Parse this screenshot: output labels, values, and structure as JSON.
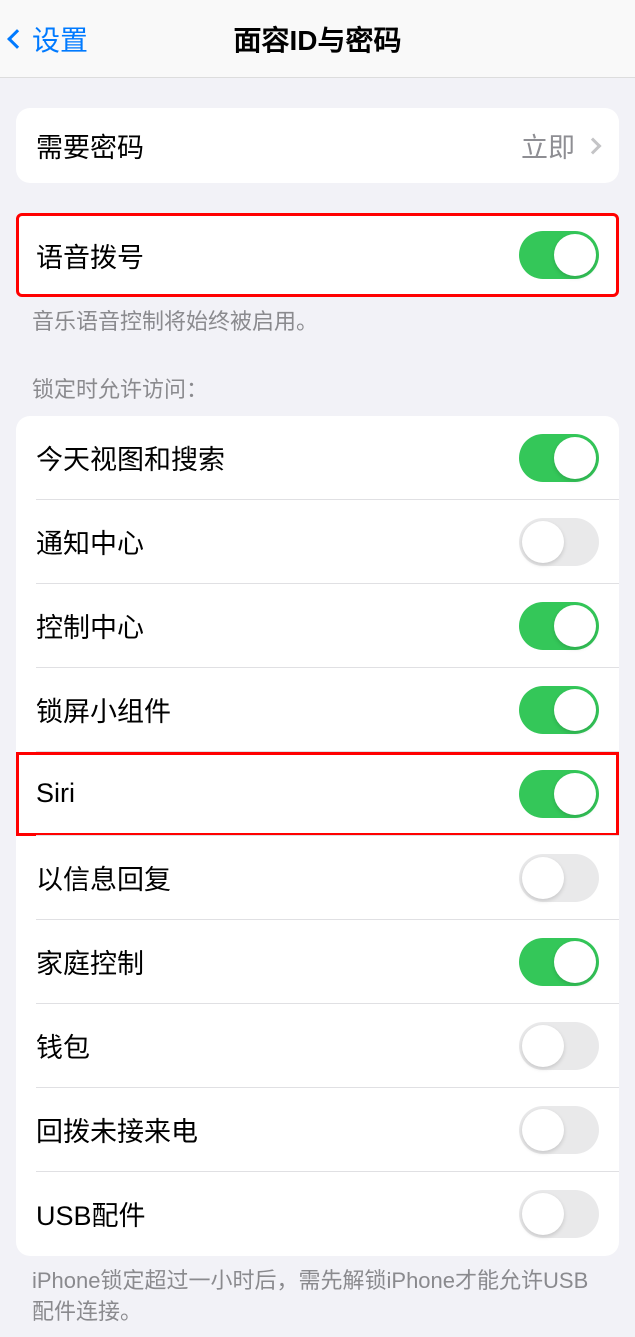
{
  "header": {
    "back_label": "设置",
    "title": "面容ID与密码"
  },
  "require_passcode": {
    "label": "需要密码",
    "value": "立即"
  },
  "voice_dial": {
    "label": "语音拨号",
    "enabled": true,
    "footer": "音乐语音控制将始终被启用。"
  },
  "lock_section": {
    "header": "锁定时允许访问：",
    "items": [
      {
        "label": "今天视图和搜索",
        "enabled": true,
        "highlighted": false
      },
      {
        "label": "通知中心",
        "enabled": false,
        "highlighted": false
      },
      {
        "label": "控制中心",
        "enabled": true,
        "highlighted": false
      },
      {
        "label": "锁屏小组件",
        "enabled": true,
        "highlighted": false
      },
      {
        "label": "Siri",
        "enabled": true,
        "highlighted": true
      },
      {
        "label": "以信息回复",
        "enabled": false,
        "highlighted": false
      },
      {
        "label": "家庭控制",
        "enabled": true,
        "highlighted": false
      },
      {
        "label": "钱包",
        "enabled": false,
        "highlighted": false
      },
      {
        "label": "回拨未接来电",
        "enabled": false,
        "highlighted": false
      },
      {
        "label": "USB配件",
        "enabled": false,
        "highlighted": false
      }
    ],
    "footer": "iPhone锁定超过一小时后，需先解锁iPhone才能允许USB配件连接。"
  }
}
